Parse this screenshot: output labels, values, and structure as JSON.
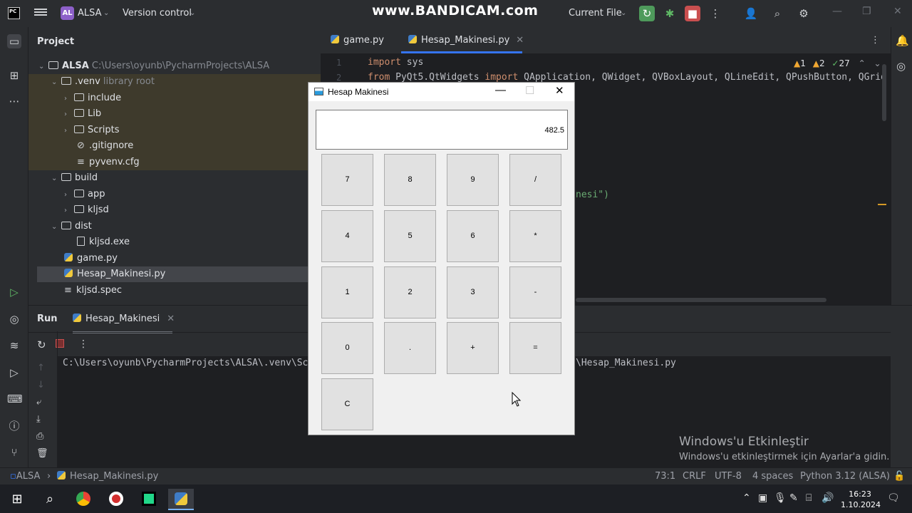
{
  "titlebar": {
    "logo": "PC",
    "project_badge": "AL",
    "project_name": "ALSA",
    "vcs": "Version control",
    "watermark": "www.BANDICAM.com",
    "run_config": "Current File"
  },
  "project_panel": {
    "title": "Project",
    "root": {
      "name": "ALSA",
      "path": "C:\\Users\\oyunb\\PycharmProjects\\ALSA"
    },
    "venv": {
      "name": ".venv",
      "hint": "library root"
    },
    "items": [
      {
        "label": "include"
      },
      {
        "label": "Lib"
      },
      {
        "label": "Scripts"
      },
      {
        "label": ".gitignore"
      },
      {
        "label": "pyvenv.cfg"
      },
      {
        "label": "build"
      },
      {
        "label": "app"
      },
      {
        "label": "kljsd"
      },
      {
        "label": "dist"
      },
      {
        "label": "kljsd.exe"
      },
      {
        "label": "game.py"
      },
      {
        "label": "Hesap_Makinesi.py"
      },
      {
        "label": "kljsd.spec"
      }
    ]
  },
  "editor": {
    "tabs": [
      {
        "label": "game.py"
      },
      {
        "label": "Hesap_Makinesi.py"
      }
    ],
    "inspections": {
      "warnings": "1",
      "weak": "2",
      "ok": "27"
    },
    "lines": [
      {
        "no": "1",
        "kw": "import",
        "rest": " sys"
      },
      {
        "no": "2",
        "kw": "from",
        "rest": " PyQt5.QtWidgets ",
        "kw2": "import",
        "rest2": " QApplication, QWidget, QVBoxLayout, QLineEdit, QPushButton, QGridLayo"
      }
    ],
    "partial_line": "nesi\")"
  },
  "run_panel": {
    "title": "Run",
    "tab": "Hesap_Makinesi",
    "output_left": "C:\\Users\\oyunb\\PycharmProjects\\ALSA\\.venv\\Scri",
    "output_right": "\\Hesap_Makinesi.py"
  },
  "statusbar": {
    "crumb_project": "ALSA",
    "crumb_file": "Hesap_Makinesi.py",
    "position": "73:1",
    "line_sep": "CRLF",
    "encoding": "UTF-8",
    "indent": "4 spaces",
    "interpreter": "Python 3.12 (ALSA)"
  },
  "watermark": {
    "line1": "Windows'u Etkinleştir",
    "line2": "Windows'u etkinleştirmek için Ayarlar'a gidin."
  },
  "taskbar": {
    "time": "16:23",
    "date": "1.10.2024"
  },
  "calculator": {
    "title": "Hesap Makinesi",
    "display": "482.5",
    "buttons": [
      {
        "label": "7"
      },
      {
        "label": "8"
      },
      {
        "label": "9"
      },
      {
        "label": "/"
      },
      {
        "label": "4"
      },
      {
        "label": "5"
      },
      {
        "label": "6"
      },
      {
        "label": "*"
      },
      {
        "label": "1"
      },
      {
        "label": "2"
      },
      {
        "label": "3"
      },
      {
        "label": "-"
      },
      {
        "label": "0"
      },
      {
        "label": "."
      },
      {
        "label": "+"
      },
      {
        "label": "="
      },
      {
        "label": "C"
      }
    ]
  }
}
